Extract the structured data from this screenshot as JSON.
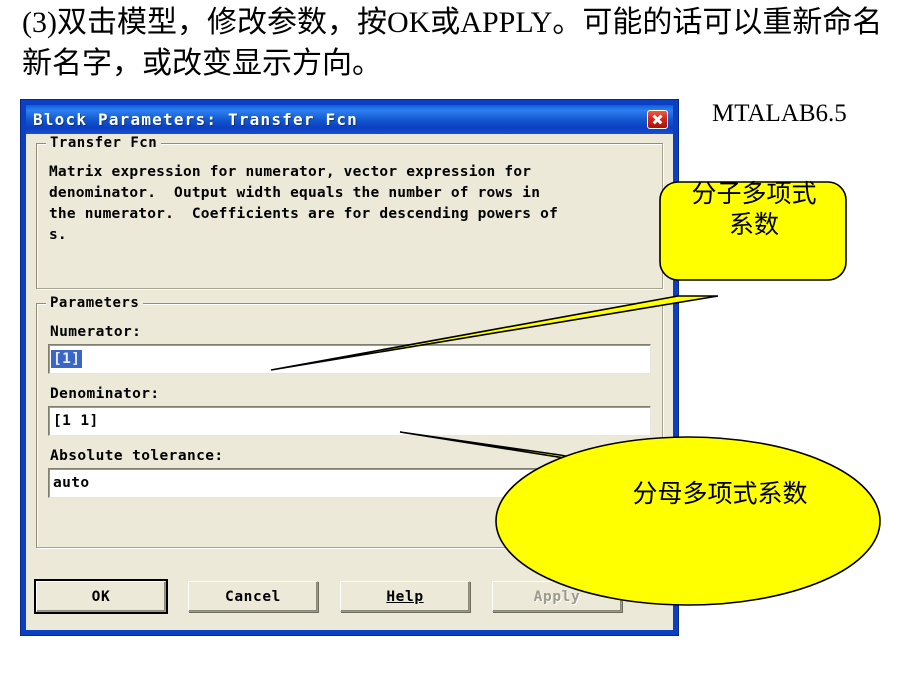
{
  "slide": {
    "heading": "(3)双击模型，修改参数，按OK或APPLY。可能的话可以重新命名新名字，或改变显示方向。",
    "caption": "MTALAB6.5"
  },
  "dialog": {
    "title": "Block Parameters: Transfer Fcn",
    "close_icon": "close-icon",
    "description_group": {
      "legend": "Transfer Fcn",
      "text": "Matrix expression for numerator, vector expression for\ndenominator.  Output width equals the number of rows in\nthe numerator.  Coefficients are for descending powers of\ns."
    },
    "parameters_group": {
      "legend": "Parameters",
      "fields": [
        {
          "label": "Numerator:",
          "value": "[1]",
          "selected": true
        },
        {
          "label": "Denominator:",
          "value": "[1 1]",
          "selected": false
        },
        {
          "label": "Absolute tolerance:",
          "value": "auto",
          "selected": false
        }
      ]
    },
    "buttons": [
      {
        "label": "OK",
        "state": "default"
      },
      {
        "label": "Cancel",
        "state": "normal"
      },
      {
        "label": "Help",
        "state": "normal",
        "mnemonic": "H"
      },
      {
        "label": "Apply",
        "state": "disabled"
      }
    ]
  },
  "callouts": [
    {
      "shape": "rounded-rect",
      "text": "分子多项式\n系数",
      "color": "#ffff00",
      "points_to": "Numerator"
    },
    {
      "shape": "ellipse",
      "text": "分母多项式系数",
      "color": "#ffff00",
      "points_to": "Denominator"
    }
  ]
}
